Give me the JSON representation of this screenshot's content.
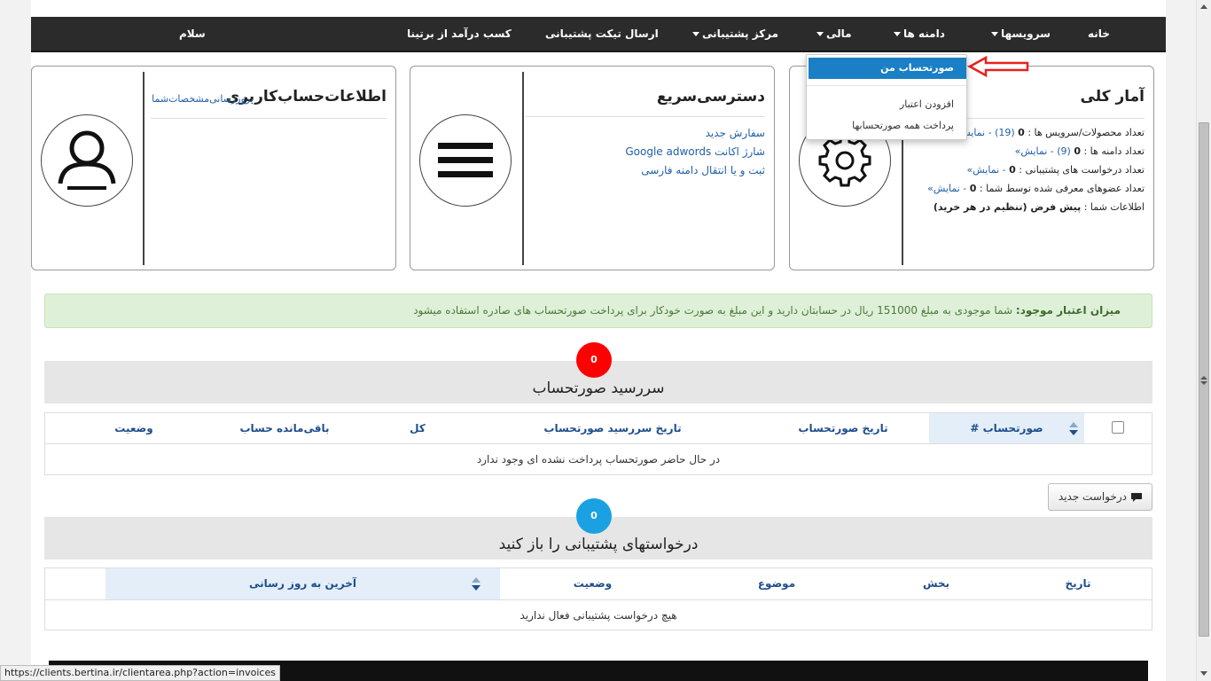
{
  "nav": {
    "home": "خانه",
    "services": "سرویسها",
    "domains": "دامنه ها",
    "billing": "مالی",
    "support_center": "مرکز پشتیبانی",
    "open_ticket": "ارسال تیکت پشتیبانی",
    "affiliates": "کسب درآمد از برتینا",
    "greeting": "سلام"
  },
  "billing_menu": {
    "my_invoices": "صورتحساب من",
    "add_funds": "افزودن اعتبار",
    "mass_pay": "پرداخت همه صورتحسابها"
  },
  "stats_panel": {
    "title": "آمار کلی",
    "products_label": "تعداد محصولات/سرویس ها :",
    "products_active": "0",
    "products_total": "(19)",
    "products_link": "- نمایش",
    "domains_label": "تعداد دامنه ها :",
    "domains_active": "0",
    "domains_total": "(9)",
    "domains_link": "- نمایش»",
    "tickets_label": "تعداد درخواست های پشتیبانی :",
    "tickets_count": "0",
    "tickets_link": "- نمایش»",
    "referrals_label": "تعداد عضوهای معرفی شده توسط شما :",
    "referrals_count": "0",
    "referrals_link": "- نمایش»",
    "info_label": "اطلاعات شما :",
    "info_value": "پیش فرض (تنظیم در هر خرید)"
  },
  "quick_panel": {
    "title": "دسترسی‌سریع",
    "links": [
      "سفارش جدید",
      "شارژ اکانت Google adwords",
      "ثبت و یا انتقال دامنه فارسی"
    ]
  },
  "account_panel": {
    "title": "اطلاعات‌حساب‌کاربری",
    "update_link": "بروزرسانی‌مشخصات‌شما"
  },
  "alert": {
    "label": "میزان اعتبار موجود:",
    "text": "شما موجودی به مبلغ 151000 ریال در حسابتان دارید و این مبلغ به صورت خودکار برای پرداخت صورتحساب های صادره استفاده میشود"
  },
  "invoices": {
    "badge": "0",
    "title": "سررسید صورتحساب",
    "columns": [
      "صورتحساب #",
      "تاریخ صورتحساب",
      "تاریخ سررسید صورتحساب",
      "کل",
      "باقی‌مانده حساب",
      "وضعیت"
    ],
    "empty": "در حال حاضر صورتحساب پرداخت نشده ای وجود ندارد"
  },
  "new_ticket_button": "درخواست جدید",
  "tickets": {
    "badge": "0",
    "title": "درخواستهای پشتیبانی را باز کنید",
    "columns": [
      "تاریخ",
      "بخش",
      "موضوع",
      "وضعیت",
      "آخرین به روز رسانی"
    ],
    "empty": "هیچ درخواست پشتیبانی فعال ندارید"
  },
  "status_url": "https://clients.bertina.ir/clientarea.php?action=invoices",
  "colors": {
    "nav_bg": "#2b2b2b",
    "accent_blue": "#1a7fc5",
    "badge_red": "#ff0000",
    "badge_blue": "#1ba1e2",
    "alert_bg": "#dff0d8",
    "arrow_red": "#e8201e"
  },
  "icons": {
    "stats": "gear-icon",
    "quick": "menu-icon",
    "account": "user-icon",
    "ticket": "comment-icon",
    "pointer": "arrow-left-icon"
  }
}
